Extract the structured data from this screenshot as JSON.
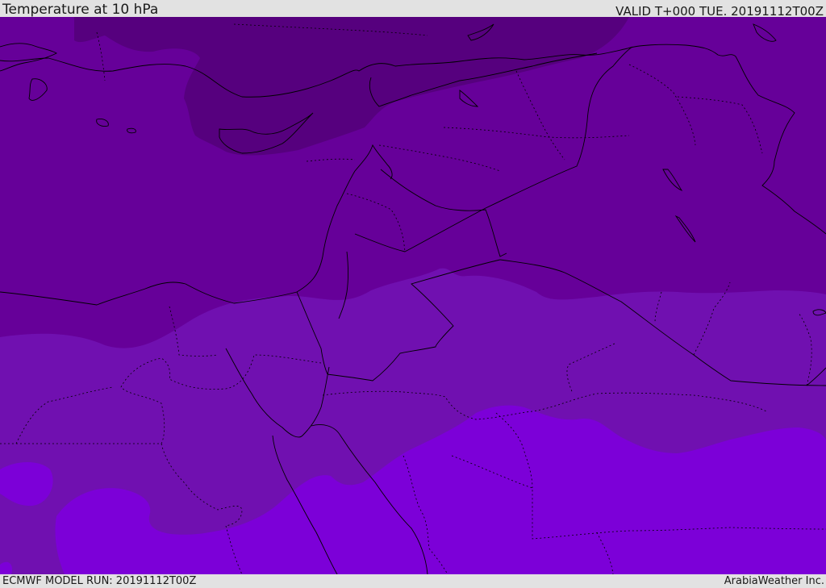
{
  "header": {
    "title": "Temperature at 10 hPa",
    "valid": "VALID T+000 TUE. 20191112T00Z"
  },
  "footer": {
    "model_run": "ECMWF MODEL RUN: 20191112T00Z",
    "credit": "ArabiaWeather Inc."
  },
  "colors": {
    "coldest_band": "#56007e",
    "cold_band": "#660099",
    "mid_band": "#7010b0",
    "warm_band": "#7c00d8",
    "coastline": "#000000",
    "borders": "#000000"
  }
}
